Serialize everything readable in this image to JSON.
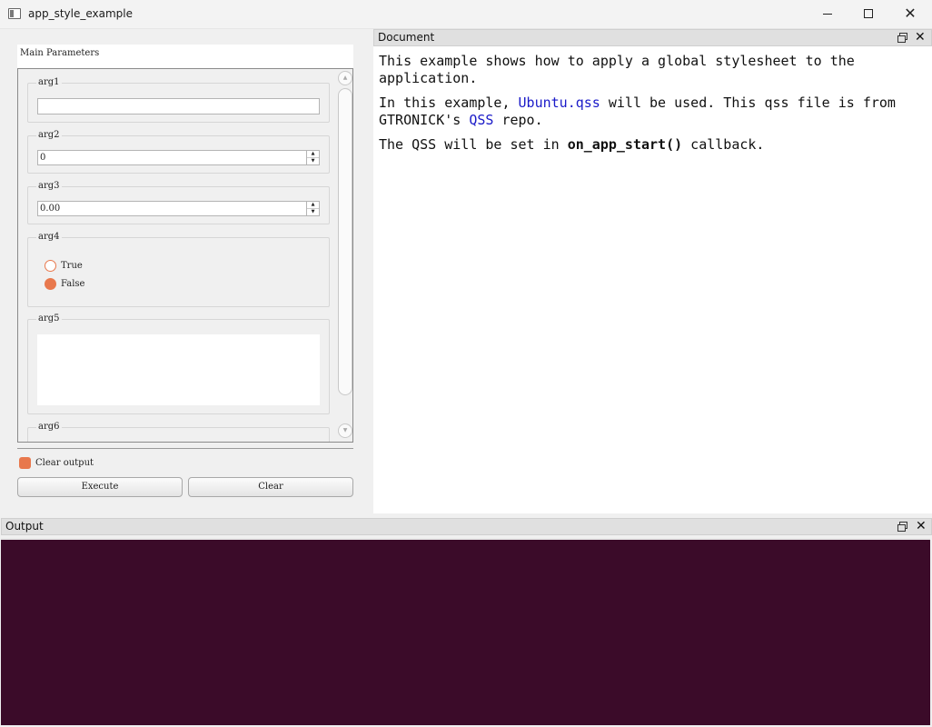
{
  "window": {
    "title": "app_style_example",
    "controls": {
      "minimize": "minimize",
      "maximize": "maximize",
      "close": "✕"
    }
  },
  "params": {
    "title": "Main Parameters",
    "arg1": {
      "label": "arg1",
      "value": ""
    },
    "arg2": {
      "label": "arg2",
      "value": "0"
    },
    "arg3": {
      "label": "arg3",
      "value": "0.00"
    },
    "arg4": {
      "label": "arg4",
      "options": [
        "True",
        "False"
      ],
      "selected": "False"
    },
    "arg5": {
      "label": "arg5",
      "value": ""
    },
    "arg6": {
      "label": "arg6"
    },
    "clear_output_label": "Clear output",
    "clear_output_checked": true,
    "execute_label": "Execute",
    "clear_label": "Clear"
  },
  "document": {
    "title": "Document",
    "line1": "This example shows how to apply a global stylesheet to the application.",
    "line2_a": "In this example, ",
    "line2_link1": "Ubuntu.qss",
    "line2_b": " will be used. This qss file is from GTRONICK's ",
    "line2_link2": "QSS",
    "line2_c": " repo.",
    "line3_a": "The QSS will be set in ",
    "line3_bold": "on_app_start()",
    "line3_b": " callback."
  },
  "output": {
    "title": "Output",
    "background": "#3b0b29"
  },
  "colors": {
    "accent": "#e8784d",
    "link": "#1a1ac8"
  }
}
